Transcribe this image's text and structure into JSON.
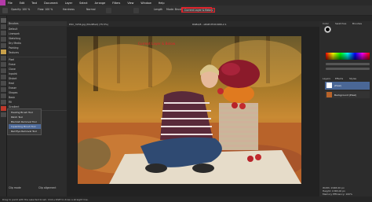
{
  "menubar": {
    "items": [
      "File",
      "Edit",
      "Text",
      "Document",
      "Layer",
      "Select",
      "Arrange",
      "Filters",
      "View",
      "Window",
      "Help"
    ]
  },
  "toolbar": {
    "opacity_label": "Opacity: 100 %",
    "flow_label": "Flow: 100 %",
    "hardness_label": "Hardness",
    "blend_label": "Normal",
    "length_label": "Length",
    "mode_label": "Mode: Brush",
    "current_layer": "Current Layer & Below"
  },
  "document": {
    "tab_label": "DSC_3234.jpg (Modified) (75.5%)",
    "info_label": "RGBA/8 - sRGB IEC61966-2.1"
  },
  "left_panel": {
    "rows": [
      "Brushes",
      "Default",
      "Linework",
      "Sketching",
      "Dry Media",
      "Painting",
      "Textures",
      "Pixel",
      "Erase",
      "Clone",
      "Inpaint",
      "Distort",
      "Heal",
      "Eraser",
      "Shapes",
      "Basic",
      "Fill",
      "Gradient",
      "Flip Horizontal",
      "Flip Vertical",
      "Dodge",
      "Burn"
    ],
    "bottom_left": "Clip mode",
    "bottom_right": "Clip alignment"
  },
  "popup": {
    "items": [
      "Healing Brush Tool",
      "Patch Tool",
      "Blemish Removal Tool",
      "Inpainting Brush Tool",
      "Red Eye Removal Tool"
    ],
    "selected_index": 3
  },
  "annotations": {
    "current_layer_below": "Current Layer & Below",
    "new_pixel_layer": "New Pixel Layer"
  },
  "right_panel": {
    "tabs": [
      "Color",
      "Swatches",
      "Brushes"
    ],
    "layer_tabs": [
      "Layers",
      "Effects",
      "Styles"
    ],
    "layers": [
      {
        "name": "(Pixel)",
        "selected": true
      },
      {
        "name": "Background (Pixel)",
        "selected": false
      }
    ],
    "footer_a": "Width: 2048.00 px",
    "footer_b": "Height: 1365.00 px",
    "footer_c": "Memory Efficiency: 100%"
  },
  "status": {
    "text": "Drag to paint with the selected brush. Click+Shift to draw a straight line."
  },
  "colors": {
    "accent": "#4a6796",
    "annotation": "#e0242c",
    "app_logo": "#b33aa8"
  }
}
